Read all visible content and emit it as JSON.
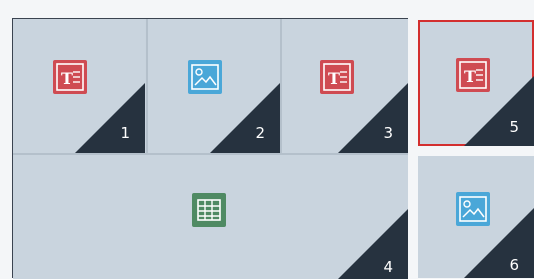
{
  "tiles": [
    {
      "id": 1,
      "label": "1",
      "icon": "text-icon",
      "color": "#cf4b52"
    },
    {
      "id": 2,
      "label": "2",
      "icon": "image-icon",
      "color": "#4aa7d8"
    },
    {
      "id": 3,
      "label": "3",
      "icon": "text-icon",
      "color": "#cf4b52"
    },
    {
      "id": 4,
      "label": "4",
      "icon": "table-icon",
      "color": "#4f8a63"
    },
    {
      "id": 5,
      "label": "5",
      "icon": "text-icon",
      "color": "#cf4b52",
      "selected": true
    },
    {
      "id": 6,
      "label": "6",
      "icon": "image-icon",
      "color": "#4aa7d8"
    }
  ],
  "colors": {
    "background": "#c9d4de",
    "corner": "#26323f",
    "selection": "#d32f2f",
    "border": "#3a4350"
  }
}
